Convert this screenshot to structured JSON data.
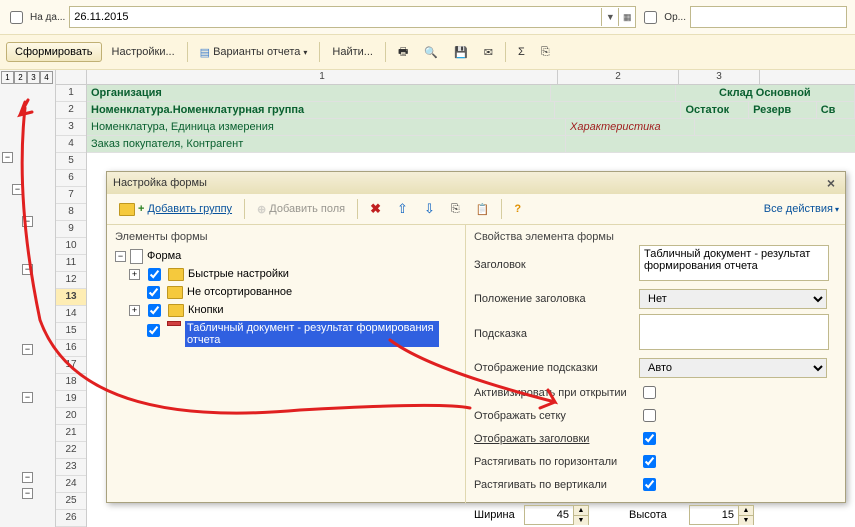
{
  "topbar": {
    "date_label": "На да...",
    "date_value": "26.11.2015",
    "org_label": "Ор...",
    "org_value": ""
  },
  "toolbar": {
    "generate": "Сформировать",
    "settings": "Настройки...",
    "variants": "Варианты отчета",
    "find": "Найти..."
  },
  "outline_levels": [
    "1",
    "2",
    "3",
    "4"
  ],
  "col_headers": {
    "c1": "1",
    "c2": "2",
    "c3": "3"
  },
  "right_header": "Склад Основной",
  "cols": {
    "ostatok": "Остаток",
    "reserv": "Резерв",
    "sv": "Св"
  },
  "rows": {
    "r1": "Организация",
    "r2": "Номенклатура.Номенклатурная группа",
    "r3a": "Номенклатура, Единица измерения",
    "r3b": "Характеристика",
    "r4": "Заказ покупателя, Контрагент"
  },
  "row_nums": [
    "1",
    "2",
    "3",
    "4",
    "5",
    "6",
    "7",
    "8",
    "9",
    "10",
    "11",
    "12",
    "13",
    "14",
    "15",
    "16",
    "17",
    "18",
    "19",
    "20",
    "21",
    "22",
    "23",
    "24",
    "25",
    "26"
  ],
  "dialog": {
    "title": "Настройка формы",
    "add_group": "Добавить группу",
    "add_fields": "Добавить поля",
    "all_actions": "Все действия",
    "left_header": "Элементы формы",
    "right_header": "Свойства элемента формы",
    "tree": {
      "root": "Форма",
      "n1": "Быстрые настройки",
      "n2": "Не отсортированное",
      "n3": "Кнопки",
      "n4": "Табличный документ - результат формирования отчета"
    },
    "props": {
      "title_lbl": "Заголовок",
      "title_val": "Табличный документ - результат формирования отчета",
      "title_pos_lbl": "Положение заголовка",
      "title_pos_val": "Нет",
      "hint_lbl": "Подсказка",
      "hint_val": "",
      "hint_disp_lbl": "Отображение подсказки",
      "hint_disp_val": "Авто",
      "activate_lbl": "Активизировать при открытии",
      "show_grid_lbl": "Отображать сетку",
      "show_headers_lbl": "Отображать заголовки",
      "stretch_h_lbl": "Растягивать по горизонтали",
      "stretch_v_lbl": "Растягивать по вертикали",
      "width_lbl": "Ширина",
      "width_val": "45",
      "height_lbl": "Высота",
      "height_val": "15"
    }
  }
}
